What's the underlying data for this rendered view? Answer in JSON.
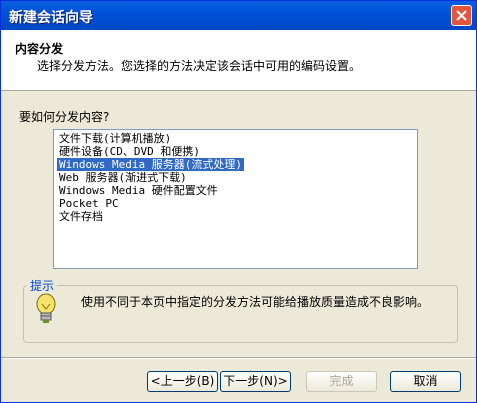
{
  "window": {
    "title": "新建会话向导"
  },
  "header": {
    "title": "内容分发",
    "description": "选择分发方法。您选择的方法决定该会话中可用的编码设置。"
  },
  "question": "要如何分发内容?",
  "list": {
    "items": [
      "文件下载(计算机播放)",
      "硬件设备(CD、DVD 和便携)",
      "Windows Media 服务器(流式处理)",
      "Web 服务器(渐进式下载)",
      "Windows Media 硬件配置文件",
      "Pocket PC",
      "文件存档"
    ],
    "selected_index": 2
  },
  "tip": {
    "legend": "提示",
    "text": "使用不同于本页中指定的分发方法可能给播放质量造成不良影响。"
  },
  "buttons": {
    "back": "<上一步(B)",
    "next": "下一步(N)>",
    "finish": "完成",
    "cancel": "取消"
  },
  "colors": {
    "titlebar": "#0052d8",
    "selection": "#316ac5",
    "tip_legend": "#0046d5"
  }
}
